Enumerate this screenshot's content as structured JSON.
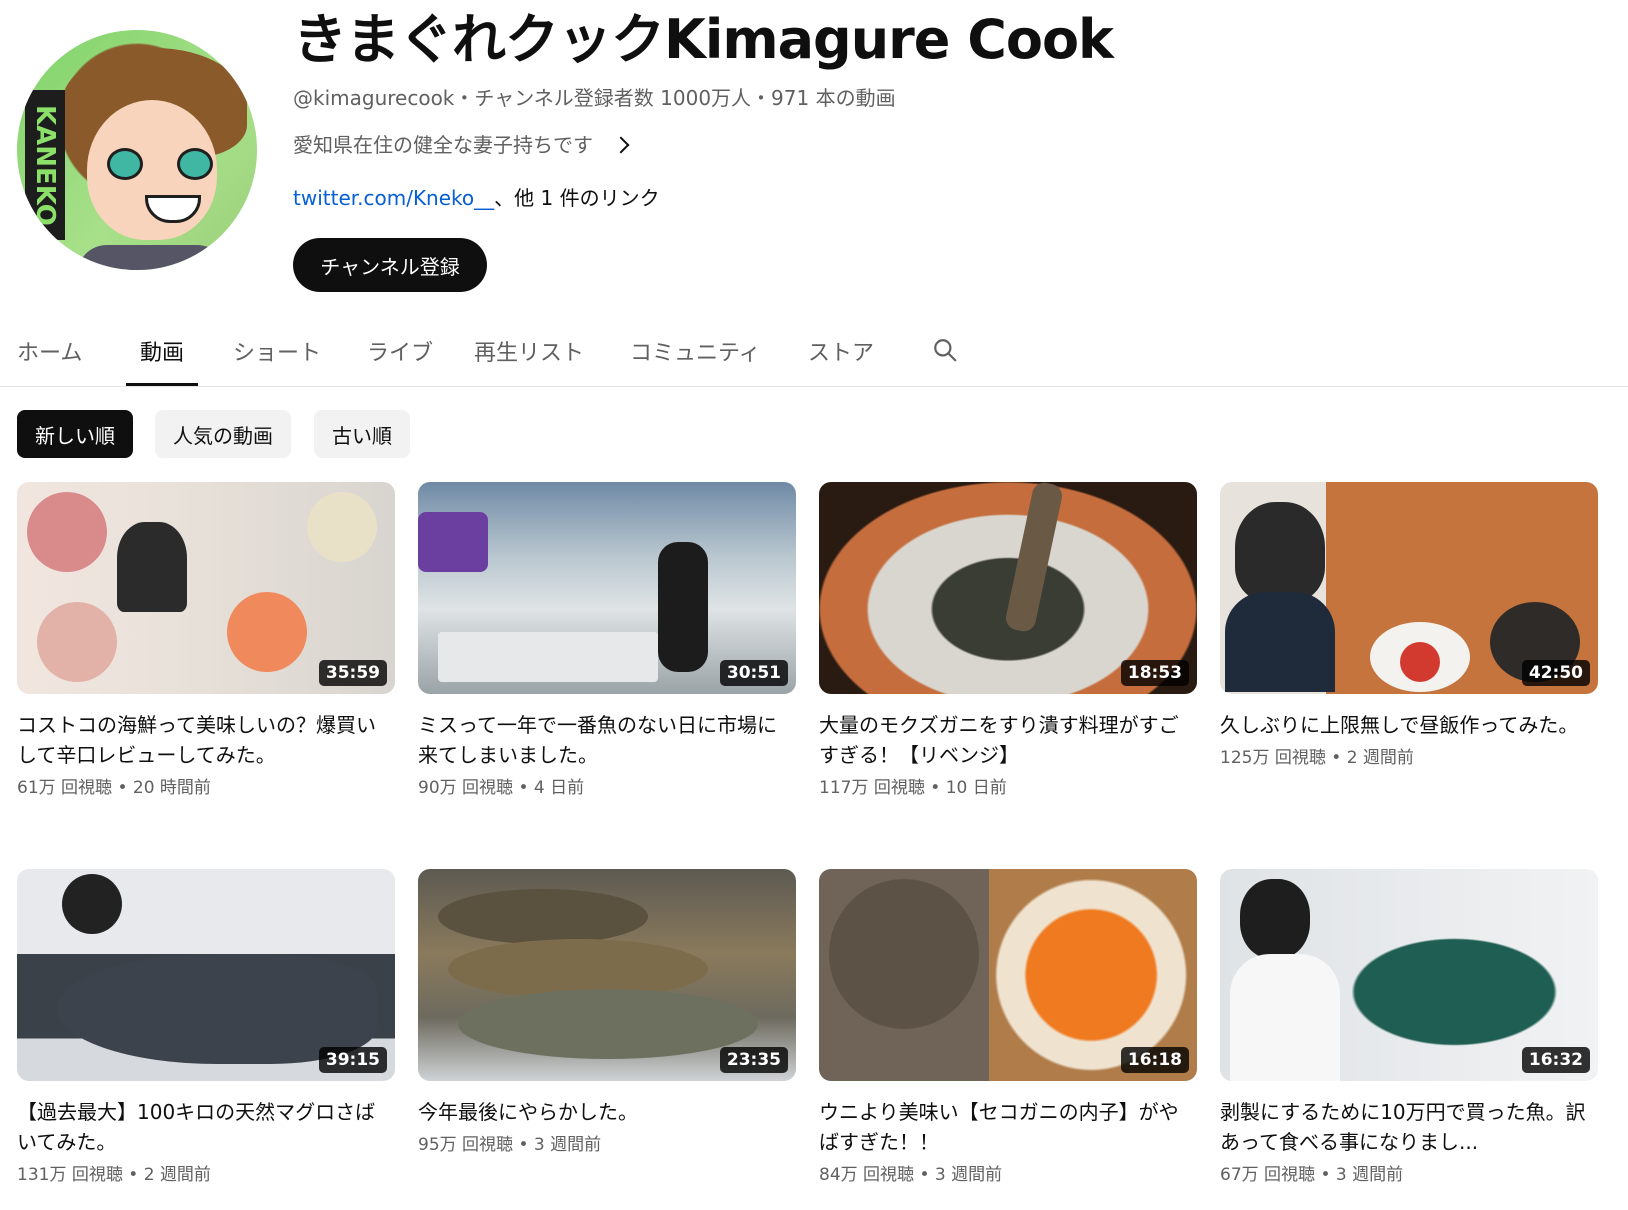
{
  "channel": {
    "name": "きまぐれクックKimagure Cook",
    "handle": "@kimagurecook",
    "subscribers": "チャンネル登録者数 1000万人",
    "video_count": "971 本の動画",
    "description": "愛知県在住の健全な妻子持ちです",
    "link_text": "twitter.com/Kneko__",
    "more_links": "、他 1 件のリンク",
    "subscribe_label": "チャンネル登録",
    "avatar_text": "KANEKO"
  },
  "tabs": [
    {
      "label": "ホーム"
    },
    {
      "label": "動画"
    },
    {
      "label": "ショート"
    },
    {
      "label": "ライブ"
    },
    {
      "label": "再生リスト"
    },
    {
      "label": "コミュニティ"
    },
    {
      "label": "ストア"
    }
  ],
  "active_tab": "動画",
  "chips": [
    {
      "label": "新しい順"
    },
    {
      "label": "人気の動画"
    },
    {
      "label": "古い順"
    }
  ],
  "videos": [
    {
      "title": "コストコの海鮮って美味しいの？爆買いして辛口レビューしてみた。",
      "duration": "35:59",
      "views": "61万 回視聴",
      "age": "20 時間前"
    },
    {
      "title": "ミスって一年で一番魚のない日に市場に来てしまいました。",
      "duration": "30:51",
      "views": "90万 回視聴",
      "age": "4 日前"
    },
    {
      "title": "大量のモクズガニをすり潰す料理がすごすぎる！【リベンジ】",
      "duration": "18:53",
      "views": "117万 回視聴",
      "age": "10 日前"
    },
    {
      "title": "久しぶりに上限無しで昼飯作ってみた。",
      "duration": "42:50",
      "views": "125万 回視聴",
      "age": "2 週間前"
    },
    {
      "title": "【過去最大】100キロの天然マグロさばいてみた。",
      "duration": "39:15",
      "views": "131万 回視聴",
      "age": "2 週間前"
    },
    {
      "title": "今年最後にやらかした。",
      "duration": "23:35",
      "views": "95万 回視聴",
      "age": "3 週間前"
    },
    {
      "title": "ウニより美味い【セコガニの内子】がやばすぎた！！",
      "duration": "16:18",
      "views": "84万 回視聴",
      "age": "3 週間前"
    },
    {
      "title": "剥製にするために10万円で買った魚。訳あって食べる事になりまし...",
      "duration": "16:32",
      "views": "67万 回視聴",
      "age": "3 週間前"
    }
  ],
  "separator": "・",
  "meta_separator": " • "
}
